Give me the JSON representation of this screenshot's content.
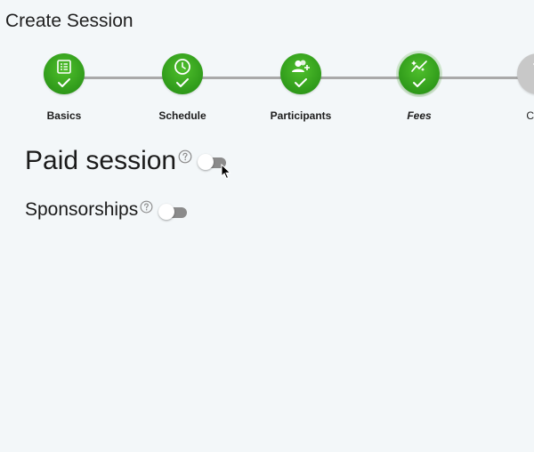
{
  "page": {
    "title": "Create Session"
  },
  "stepper": {
    "steps": [
      {
        "label": "Basics",
        "icon": "list-icon",
        "status": "complete"
      },
      {
        "label": "Schedule",
        "icon": "clock-icon",
        "status": "complete"
      },
      {
        "label": "Participants",
        "icon": "add-user-icon",
        "status": "complete"
      },
      {
        "label": "Fees",
        "icon": "magic-wand-icon",
        "status": "current"
      },
      {
        "label": "Com",
        "icon": "check-icon",
        "status": "pending"
      }
    ]
  },
  "fees": {
    "paid_session": {
      "label": "Paid session",
      "help_icon": "help-circle-icon",
      "enabled": false
    },
    "sponsorships": {
      "label": "Sponsorships",
      "help_icon": "help-circle-icon",
      "enabled": false
    }
  },
  "colors": {
    "step_complete": "#35a01c",
    "step_pending": "#c8c8c8",
    "connector": "#a9a9a9",
    "toggle_track_off": "#8b8b8b",
    "background": "#f3f7f9"
  }
}
